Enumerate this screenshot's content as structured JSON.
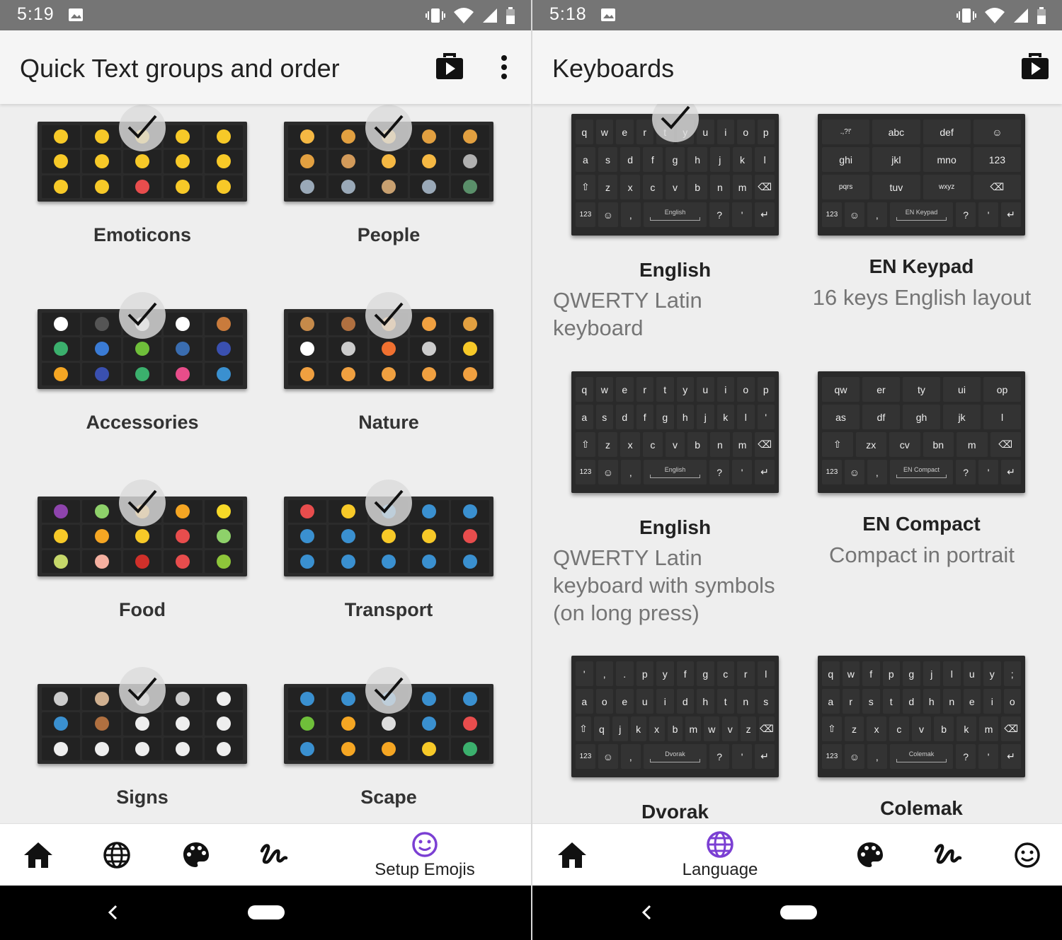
{
  "left": {
    "status_time": "5:19",
    "title": "Quick Text groups and order",
    "groups": [
      {
        "label": "Emoticons",
        "colors": [
          "#f7c928",
          "#f7c928",
          "#f7c928",
          "#f7c928",
          "#f7c928",
          "#f7c928",
          "#f7c928",
          "#f7c928",
          "#f7c928",
          "#f7c928",
          "#f7c928",
          "#f7c928",
          "#e84d4d",
          "#f7c928",
          "#f7c928"
        ]
      },
      {
        "label": "People",
        "colors": [
          "#f5b843",
          "#e2a040",
          "#f5b843",
          "#e2a040",
          "#e2a040",
          "#e2a040",
          "#d29a5a",
          "#f5b843",
          "#f5b843",
          "#b0b0b0",
          "#9aa9b8",
          "#9aa9b8",
          "#c8a070",
          "#9aa9b8",
          "#5a8f6a"
        ]
      },
      {
        "label": "Accessories",
        "colors": [
          "#ffffff",
          "#555555",
          "#ffffff",
          "#ffffff",
          "#c97b3c",
          "#3bb06d",
          "#3a7bd5",
          "#6fbf3a",
          "#3a6db0",
          "#3a50b0",
          "#f5a623",
          "#3a50b0",
          "#3bb06d",
          "#e84d8a",
          "#3a90d0"
        ]
      },
      {
        "label": "Nature",
        "colors": [
          "#c58a4a",
          "#b07040",
          "#f0a040",
          "#f0a040",
          "#e2a040",
          "#ffffff",
          "#cccccc",
          "#f07030",
          "#cccccc",
          "#f7c928",
          "#f0a040",
          "#f0a040",
          "#f0a040",
          "#f0a040",
          "#f0a040"
        ]
      },
      {
        "label": "Food",
        "colors": [
          "#8e44ad",
          "#8ed16a",
          "#f5a623",
          "#f5a623",
          "#f7d928",
          "#f7c928",
          "#f5a623",
          "#f7c928",
          "#e84d4d",
          "#8ed16a",
          "#c6d86a",
          "#f5b0a0",
          "#d0302a",
          "#e84d4d",
          "#8ec63a"
        ]
      },
      {
        "label": "Transport",
        "colors": [
          "#e84d4d",
          "#f7c928",
          "#3a90d0",
          "#3a90d0",
          "#3a90d0",
          "#3a90d0",
          "#3a90d0",
          "#f7c928",
          "#f7c928",
          "#e84d4d",
          "#3a90d0",
          "#3a90d0",
          "#3a90d0",
          "#3a90d0",
          "#3a90d0"
        ]
      },
      {
        "label": "Signs",
        "colors": [
          "#cccccc",
          "#d0b090",
          "#cccccc",
          "#cccccc",
          "#eeeeee",
          "#3a90d0",
          "#b07040",
          "#eeeeee",
          "#eeeeee",
          "#eeeeee",
          "#eeeeee",
          "#eeeeee",
          "#eeeeee",
          "#eeeeee",
          "#eeeeee"
        ]
      },
      {
        "label": "Scape",
        "colors": [
          "#3a90d0",
          "#3a90d0",
          "#3a90d0",
          "#3a90d0",
          "#3a90d0",
          "#6fbf3a",
          "#f5a623",
          "#dddddd",
          "#3a90d0",
          "#e84d4d",
          "#3a90d0",
          "#f5a623",
          "#f5a623",
          "#f7c928",
          "#3bb06d"
        ]
      }
    ],
    "nav_selected_label": "Setup Emojis"
  },
  "right": {
    "status_time": "5:18",
    "title": "Keyboards",
    "keyboards": [
      {
        "name": "English",
        "desc": [
          "QWERTY Latin",
          "keyboard"
        ],
        "space": "English",
        "rows": [
          [
            "q",
            "w",
            "e",
            "r",
            "t",
            "y",
            "u",
            "i",
            "o",
            "p"
          ],
          [
            "a",
            "s",
            "d",
            "f",
            "g",
            "h",
            "j",
            "k",
            "l"
          ],
          [
            "⇧",
            "z",
            "x",
            "c",
            "v",
            "b",
            "n",
            "m",
            "⌫"
          ]
        ]
      },
      {
        "name": "EN Keypad",
        "desc": [
          "16 keys English layout"
        ],
        "space": "EN Keypad",
        "rows": [
          [
            ".,?!'",
            "abc",
            "def",
            "☺"
          ],
          [
            "ghi",
            "jkl",
            "mno",
            "123"
          ],
          [
            "pqrs",
            "tuv",
            "wxyz",
            "⌫"
          ]
        ]
      },
      {
        "name": "English",
        "desc": [
          "QWERTY Latin",
          "keyboard with symbols",
          "(on long press)"
        ],
        "space": "English",
        "rows": [
          [
            "q",
            "w",
            "e",
            "r",
            "t",
            "y",
            "u",
            "i",
            "o",
            "p"
          ],
          [
            "a",
            "s",
            "d",
            "f",
            "g",
            "h",
            "j",
            "k",
            "l",
            "'"
          ],
          [
            "⇧",
            "z",
            "x",
            "c",
            "v",
            "b",
            "n",
            "m",
            "⌫"
          ]
        ]
      },
      {
        "name": "EN Compact",
        "desc": [
          "Compact in portrait"
        ],
        "space": "EN Compact",
        "rows": [
          [
            "qw",
            "er",
            "ty",
            "ui",
            "op"
          ],
          [
            "as",
            "df",
            "gh",
            "jk",
            "l"
          ],
          [
            "⇧",
            "zx",
            "cv",
            "bn",
            "m",
            "⌫"
          ]
        ]
      },
      {
        "name": "Dvorak",
        "desc": [],
        "space": "Dvorak",
        "rows": [
          [
            "'",
            ",",
            ".",
            "p",
            "y",
            "f",
            "g",
            "c",
            "r",
            "l"
          ],
          [
            "a",
            "o",
            "e",
            "u",
            "i",
            "d",
            "h",
            "t",
            "n",
            "s"
          ],
          [
            "⇧",
            "q",
            "j",
            "k",
            "x",
            "b",
            "m",
            "w",
            "v",
            "z",
            "⌫"
          ]
        ]
      },
      {
        "name": "Colemak",
        "desc": [],
        "space": "Colemak",
        "rows": [
          [
            "q",
            "w",
            "f",
            "p",
            "g",
            "j",
            "l",
            "u",
            "y",
            ";"
          ],
          [
            "a",
            "r",
            "s",
            "t",
            "d",
            "h",
            "n",
            "e",
            "i",
            "o"
          ],
          [
            "⇧",
            "z",
            "x",
            "c",
            "v",
            "b",
            "k",
            "m",
            "⌫"
          ]
        ]
      }
    ],
    "bottom_row": [
      "123",
      "☺",
      ",",
      "?",
      "'",
      "↵"
    ],
    "nav_selected_label": "Language"
  },
  "colors": {
    "accent": "#7b3fd3",
    "statusbar": "#757575"
  }
}
